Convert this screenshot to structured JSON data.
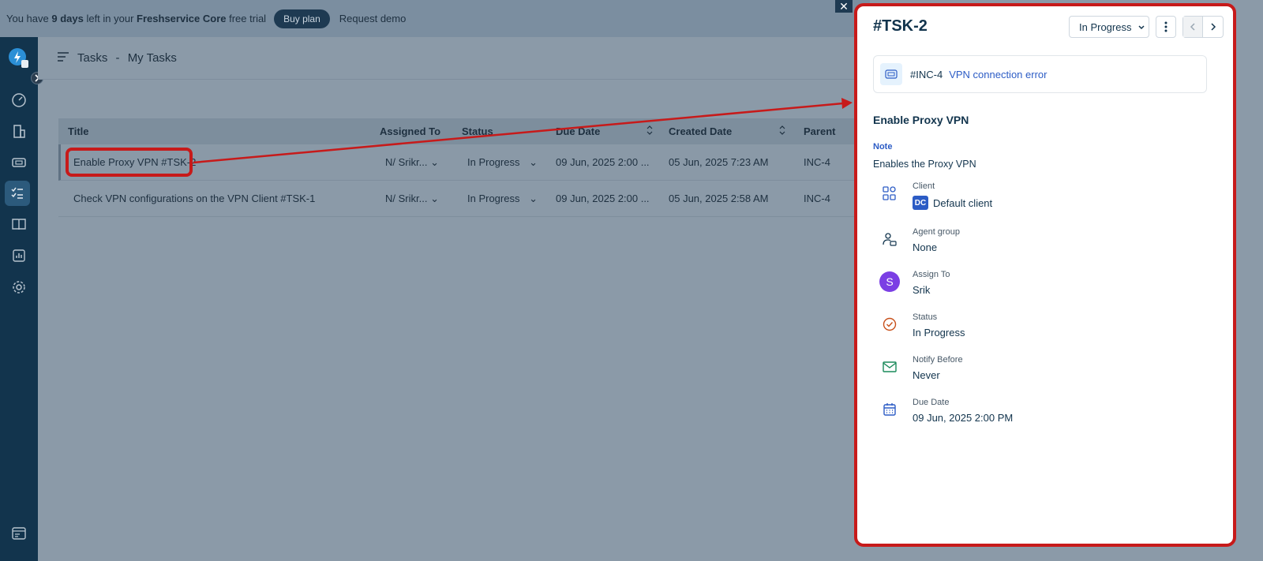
{
  "banner": {
    "prefix": "You have ",
    "days": "9 days",
    "middle": " left in your ",
    "product": "Freshservice Core",
    "suffix": " free trial",
    "buy_label": "Buy plan",
    "demo_label": "Request demo"
  },
  "header": {
    "module": "Tasks",
    "separator": "-",
    "view": "My Tasks"
  },
  "table": {
    "columns": [
      "Title",
      "Assigned To",
      "Status",
      "Due Date",
      "Created Date",
      "Parent"
    ],
    "rows": [
      {
        "title": "Enable Proxy VPN  #TSK-2",
        "assigned": "N/ Srikr...",
        "status": "In Progress",
        "due": "09 Jun, 2025 2:00 ...",
        "created": "05 Jun, 2025 7:23 AM",
        "parent": "INC-4"
      },
      {
        "title": "Check VPN configurations on the VPN Client  #TSK-1",
        "assigned": "N/ Srikr...",
        "status": "In Progress",
        "due": "09 Jun, 2025 2:00 ...",
        "created": "05 Jun, 2025 2:58 AM",
        "parent": "INC-4"
      }
    ]
  },
  "panel": {
    "title": "#TSK-2",
    "status_dropdown": "In Progress",
    "incident": {
      "id": "#INC-4",
      "subject": "VPN connection error"
    },
    "task_name": "Enable Proxy VPN",
    "note_label": "Note",
    "note_text": "Enables the Proxy VPN",
    "fields": {
      "client": {
        "label": "Client",
        "badge": "DC",
        "value": "Default client"
      },
      "agent_group": {
        "label": "Agent group",
        "value": "None"
      },
      "assign_to": {
        "label": "Assign To",
        "avatar": "S",
        "value": "Srik"
      },
      "status": {
        "label": "Status",
        "value": "In Progress"
      },
      "notify_before": {
        "label": "Notify Before",
        "value": "Never"
      },
      "due_date": {
        "label": "Due Date",
        "value": "09 Jun, 2025 2:00 PM"
      }
    }
  },
  "colors": {
    "sidebar": "#12344d",
    "annotation": "#c71a1a",
    "link": "#2c5cc5",
    "avatar": "#7b3fe4"
  },
  "icons": [
    "freshservice-logo-icon",
    "dashboard-icon",
    "building-icon",
    "ticket-icon",
    "tasks-icon",
    "book-icon",
    "chart-icon",
    "gear-icon",
    "console-icon",
    "close-icon",
    "kebab-icon",
    "chevron-left-icon",
    "chevron-right-icon"
  ]
}
